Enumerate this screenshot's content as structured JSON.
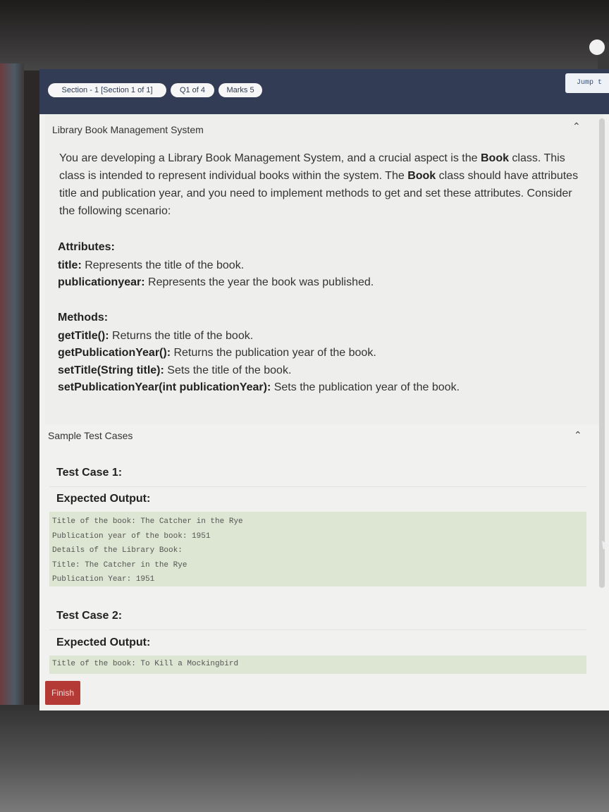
{
  "topbar": {
    "section_label": "Section - 1 [Section 1 of 1]",
    "question_label": "Q1 of 4",
    "marks_label": "Marks 5",
    "jump_label": "Jump t"
  },
  "question": {
    "title": "Library Book Management System",
    "desc_p1": "You are developing a Library Book Management System, and a crucial aspect is the ",
    "desc_b1": "Book",
    "desc_p2": " class. This class is intended to represent individual books within the system. The ",
    "desc_b2": "Book",
    "desc_p3": " class should have attributes title and publication year, and you need to implement methods to get and set these attributes. Consider the following scenario:",
    "attributes_heading": "Attributes:",
    "attributes": [
      {
        "name": "title:",
        "text": " Represents the title of the book."
      },
      {
        "name": "publicationyear:",
        "text": " Represents the year the book was published."
      }
    ],
    "methods_heading": "Methods:",
    "methods": [
      {
        "name": "getTitle():",
        "text": " Returns the title of the book."
      },
      {
        "name": "getPublicationYear():",
        "text": " Returns the publication year of the book."
      },
      {
        "name": "setTitle(String title):",
        "text": " Sets the title of the book."
      },
      {
        "name": "setPublicationYear(int publicationYear):",
        "text": " Sets the publication year of the book."
      }
    ]
  },
  "samples": {
    "title": "Sample Test Cases",
    "cases": [
      {
        "label": "Test Case 1:",
        "output_label": "Expected Output:",
        "lines": [
          "Title of the book: The Catcher in the Rye",
          "Publication year of the book: 1951",
          "Details of the Library Book:",
          "Title: The Catcher in the Rye",
          "Publication Year: 1951"
        ]
      },
      {
        "label": "Test Case 2:",
        "output_label": "Expected Output:",
        "lines": [
          "Title of the book: To Kill a Mockingbird"
        ]
      }
    ]
  },
  "footer": {
    "finish_label": "Finish"
  },
  "icons": {
    "collapse": "chevron-up-icon"
  }
}
